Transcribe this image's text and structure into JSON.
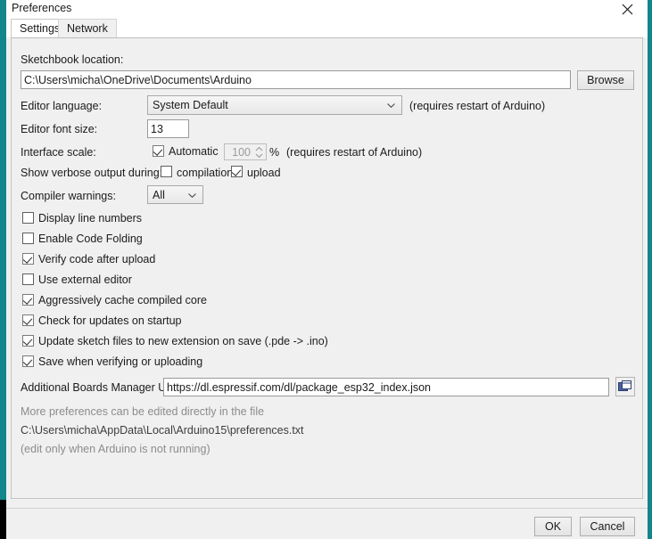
{
  "window": {
    "title": "Preferences",
    "close_icon": "close-icon"
  },
  "tabs": [
    {
      "label": "Settings",
      "selected": true
    },
    {
      "label": "Network",
      "selected": false
    }
  ],
  "settings": {
    "sketchbook": {
      "label": "Sketchbook location:",
      "value": "C:\\Users\\micha\\OneDrive\\Documents\\Arduino",
      "browse_label": "Browse"
    },
    "editor_language": {
      "label": "Editor language:",
      "value": "System Default",
      "note": "(requires restart of Arduino)"
    },
    "editor_font_size": {
      "label": "Editor font size:",
      "value": "13"
    },
    "interface_scale": {
      "label": "Interface scale:",
      "automatic_label": "Automatic",
      "automatic_checked": true,
      "scale_value": "100",
      "percent_label": "%",
      "note": "(requires restart of Arduino)"
    },
    "verbose_output": {
      "label": "Show verbose output during:",
      "compilation_label": "compilation",
      "compilation_checked": false,
      "upload_label": "upload",
      "upload_checked": true
    },
    "compiler_warnings": {
      "label": "Compiler warnings:",
      "value": "All"
    },
    "checkboxes": [
      {
        "label": "Display line numbers",
        "checked": false
      },
      {
        "label": "Enable Code Folding",
        "checked": false
      },
      {
        "label": "Verify code after upload",
        "checked": true
      },
      {
        "label": "Use external editor",
        "checked": false
      },
      {
        "label": "Aggressively cache compiled core",
        "checked": true
      },
      {
        "label": "Check for updates on startup",
        "checked": true
      },
      {
        "label": "Update sketch files to new extension on save (.pde -> .ino)",
        "checked": true
      },
      {
        "label": "Save when verifying or uploading",
        "checked": true
      }
    ],
    "boards_urls": {
      "label": "Additional Boards Manager URLs:",
      "value": "https://dl.espressif.com/dl/package_esp32_index.json",
      "icon": "open-window-icon"
    },
    "footnotes": {
      "line1": "More preferences can be edited directly in the file",
      "line2": "C:\\Users\\micha\\AppData\\Local\\Arduino15\\preferences.txt",
      "line3": "(edit only when Arduino is not running)"
    }
  },
  "footer": {
    "ok_label": "OK",
    "cancel_label": "Cancel"
  },
  "colors": {
    "accent": "#12868b",
    "panel_bg": "#f0f0f0",
    "text": "#1b1b1b",
    "muted_text": "#8c8c8c"
  }
}
